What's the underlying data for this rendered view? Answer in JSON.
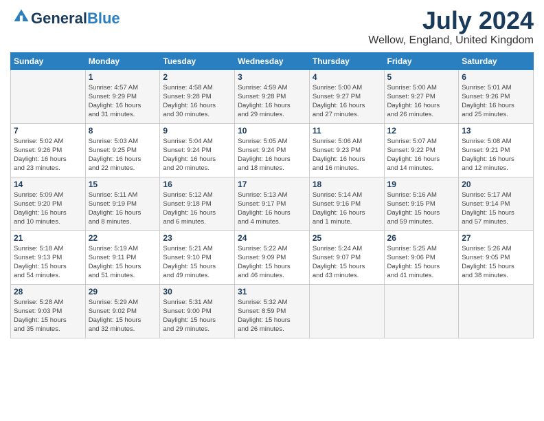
{
  "header": {
    "logo_general": "General",
    "logo_blue": "Blue",
    "month": "July 2024",
    "location": "Wellow, England, United Kingdom"
  },
  "days_of_week": [
    "Sunday",
    "Monday",
    "Tuesday",
    "Wednesday",
    "Thursday",
    "Friday",
    "Saturday"
  ],
  "weeks": [
    [
      {
        "day": "",
        "info": ""
      },
      {
        "day": "1",
        "info": "Sunrise: 4:57 AM\nSunset: 9:29 PM\nDaylight: 16 hours\nand 31 minutes."
      },
      {
        "day": "2",
        "info": "Sunrise: 4:58 AM\nSunset: 9:28 PM\nDaylight: 16 hours\nand 30 minutes."
      },
      {
        "day": "3",
        "info": "Sunrise: 4:59 AM\nSunset: 9:28 PM\nDaylight: 16 hours\nand 29 minutes."
      },
      {
        "day": "4",
        "info": "Sunrise: 5:00 AM\nSunset: 9:27 PM\nDaylight: 16 hours\nand 27 minutes."
      },
      {
        "day": "5",
        "info": "Sunrise: 5:00 AM\nSunset: 9:27 PM\nDaylight: 16 hours\nand 26 minutes."
      },
      {
        "day": "6",
        "info": "Sunrise: 5:01 AM\nSunset: 9:26 PM\nDaylight: 16 hours\nand 25 minutes."
      }
    ],
    [
      {
        "day": "7",
        "info": "Sunrise: 5:02 AM\nSunset: 9:26 PM\nDaylight: 16 hours\nand 23 minutes."
      },
      {
        "day": "8",
        "info": "Sunrise: 5:03 AM\nSunset: 9:25 PM\nDaylight: 16 hours\nand 22 minutes."
      },
      {
        "day": "9",
        "info": "Sunrise: 5:04 AM\nSunset: 9:24 PM\nDaylight: 16 hours\nand 20 minutes."
      },
      {
        "day": "10",
        "info": "Sunrise: 5:05 AM\nSunset: 9:24 PM\nDaylight: 16 hours\nand 18 minutes."
      },
      {
        "day": "11",
        "info": "Sunrise: 5:06 AM\nSunset: 9:23 PM\nDaylight: 16 hours\nand 16 minutes."
      },
      {
        "day": "12",
        "info": "Sunrise: 5:07 AM\nSunset: 9:22 PM\nDaylight: 16 hours\nand 14 minutes."
      },
      {
        "day": "13",
        "info": "Sunrise: 5:08 AM\nSunset: 9:21 PM\nDaylight: 16 hours\nand 12 minutes."
      }
    ],
    [
      {
        "day": "14",
        "info": "Sunrise: 5:09 AM\nSunset: 9:20 PM\nDaylight: 16 hours\nand 10 minutes."
      },
      {
        "day": "15",
        "info": "Sunrise: 5:11 AM\nSunset: 9:19 PM\nDaylight: 16 hours\nand 8 minutes."
      },
      {
        "day": "16",
        "info": "Sunrise: 5:12 AM\nSunset: 9:18 PM\nDaylight: 16 hours\nand 6 minutes."
      },
      {
        "day": "17",
        "info": "Sunrise: 5:13 AM\nSunset: 9:17 PM\nDaylight: 16 hours\nand 4 minutes."
      },
      {
        "day": "18",
        "info": "Sunrise: 5:14 AM\nSunset: 9:16 PM\nDaylight: 16 hours\nand 1 minute."
      },
      {
        "day": "19",
        "info": "Sunrise: 5:16 AM\nSunset: 9:15 PM\nDaylight: 15 hours\nand 59 minutes."
      },
      {
        "day": "20",
        "info": "Sunrise: 5:17 AM\nSunset: 9:14 PM\nDaylight: 15 hours\nand 57 minutes."
      }
    ],
    [
      {
        "day": "21",
        "info": "Sunrise: 5:18 AM\nSunset: 9:13 PM\nDaylight: 15 hours\nand 54 minutes."
      },
      {
        "day": "22",
        "info": "Sunrise: 5:19 AM\nSunset: 9:11 PM\nDaylight: 15 hours\nand 51 minutes."
      },
      {
        "day": "23",
        "info": "Sunrise: 5:21 AM\nSunset: 9:10 PM\nDaylight: 15 hours\nand 49 minutes."
      },
      {
        "day": "24",
        "info": "Sunrise: 5:22 AM\nSunset: 9:09 PM\nDaylight: 15 hours\nand 46 minutes."
      },
      {
        "day": "25",
        "info": "Sunrise: 5:24 AM\nSunset: 9:07 PM\nDaylight: 15 hours\nand 43 minutes."
      },
      {
        "day": "26",
        "info": "Sunrise: 5:25 AM\nSunset: 9:06 PM\nDaylight: 15 hours\nand 41 minutes."
      },
      {
        "day": "27",
        "info": "Sunrise: 5:26 AM\nSunset: 9:05 PM\nDaylight: 15 hours\nand 38 minutes."
      }
    ],
    [
      {
        "day": "28",
        "info": "Sunrise: 5:28 AM\nSunset: 9:03 PM\nDaylight: 15 hours\nand 35 minutes."
      },
      {
        "day": "29",
        "info": "Sunrise: 5:29 AM\nSunset: 9:02 PM\nDaylight: 15 hours\nand 32 minutes."
      },
      {
        "day": "30",
        "info": "Sunrise: 5:31 AM\nSunset: 9:00 PM\nDaylight: 15 hours\nand 29 minutes."
      },
      {
        "day": "31",
        "info": "Sunrise: 5:32 AM\nSunset: 8:59 PM\nDaylight: 15 hours\nand 26 minutes."
      },
      {
        "day": "",
        "info": ""
      },
      {
        "day": "",
        "info": ""
      },
      {
        "day": "",
        "info": ""
      }
    ]
  ]
}
